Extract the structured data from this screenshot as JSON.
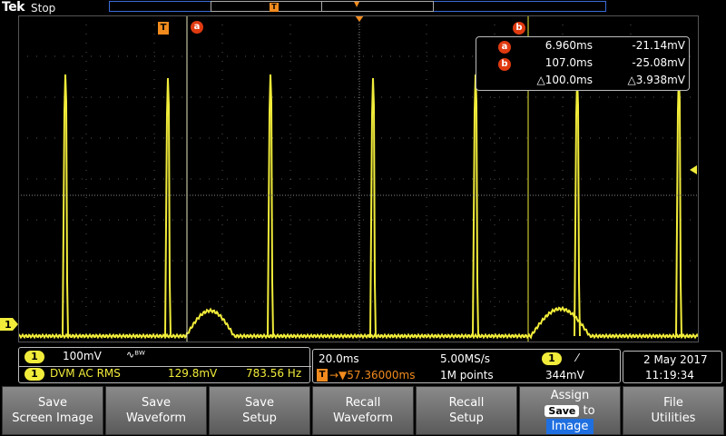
{
  "header": {
    "logo": "Tek",
    "state": "Stop"
  },
  "record_bar": {
    "trigger_marker": "T"
  },
  "cursors": {
    "trigger_label": "T",
    "a_label": "a",
    "b_label": "b"
  },
  "readout": {
    "rows": [
      {
        "label": "a",
        "time": "6.960ms",
        "value": "-21.14mV"
      },
      {
        "label": "b",
        "time": "107.0ms",
        "value": "-25.08mV"
      },
      {
        "label": "",
        "time": "△100.0ms",
        "value": "△3.938mV"
      }
    ]
  },
  "channel": {
    "number": "1",
    "color": "#f1ec3a"
  },
  "channel_box": {
    "scale": "100mV",
    "coupling_icon": "ac-coupling-icon",
    "coupling_text": "∿ᴮᵂ",
    "dvm_label": "DVM AC RMS",
    "dvm_value": "129.8mV",
    "frequency": "783.56 Hz"
  },
  "horizontal": {
    "time_div": "20.0ms",
    "sample_rate": "5.00MS/s",
    "trigger_pos": "→▼57.36000ms",
    "record_length": "1M points"
  },
  "trigger": {
    "source": "1",
    "slope": "⁄",
    "level": "344mV"
  },
  "datetime": {
    "date": "2 May  2017",
    "time": "11:19:34"
  },
  "buttons": [
    {
      "line1": "Save",
      "line2": "Screen Image"
    },
    {
      "line1": "Save",
      "line2": "Waveform"
    },
    {
      "line1": "Save",
      "line2": "Setup"
    },
    {
      "line1": "Recall",
      "line2": "Waveform"
    },
    {
      "line1": "Recall",
      "line2": "Setup"
    },
    {
      "line1": "Assign",
      "mid": "Save",
      "mid2": "to",
      "line2": "Image"
    },
    {
      "line1": "File",
      "line2": "Utilities"
    }
  ],
  "colors": {
    "trace": "#f1ec3a",
    "cursor": "#e03a10",
    "trigger": "#f28b1e",
    "record": "#3a6bd8"
  }
}
